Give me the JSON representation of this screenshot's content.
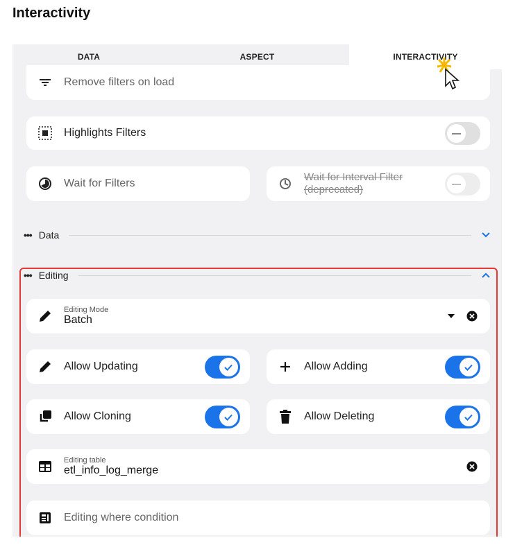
{
  "page_title": "Interactivity",
  "tabs": [
    {
      "label": "DATA"
    },
    {
      "label": "ASPECT"
    },
    {
      "label": "INTERACTIVITY"
    }
  ],
  "top_cards": {
    "remove_filters": "Remove filters on load",
    "highlights_filters": "Highlights Filters",
    "wait_for_filters": "Wait for Filters",
    "wait_interval": "Wait for Interval Filter (deprecated)"
  },
  "sections": {
    "data": "Data",
    "editing": "Editing"
  },
  "editing": {
    "mode_label": "Editing Mode",
    "mode_value": "Batch",
    "allow_updating": "Allow Updating",
    "allow_adding": "Allow Adding",
    "allow_cloning": "Allow Cloning",
    "allow_deleting": "Allow Deleting",
    "table_label": "Editing table",
    "table_value": "etl_info_log_merge",
    "where_placeholder": "Editing where condition"
  },
  "toggles": {
    "highlights_filters": false,
    "wait_interval": false,
    "allow_updating": true,
    "allow_adding": true,
    "allow_cloning": true,
    "allow_deleting": true
  },
  "colors": {
    "accent": "#1a73e8",
    "highlight_border": "#e53935",
    "panel_bg": "#f1f1f3"
  }
}
